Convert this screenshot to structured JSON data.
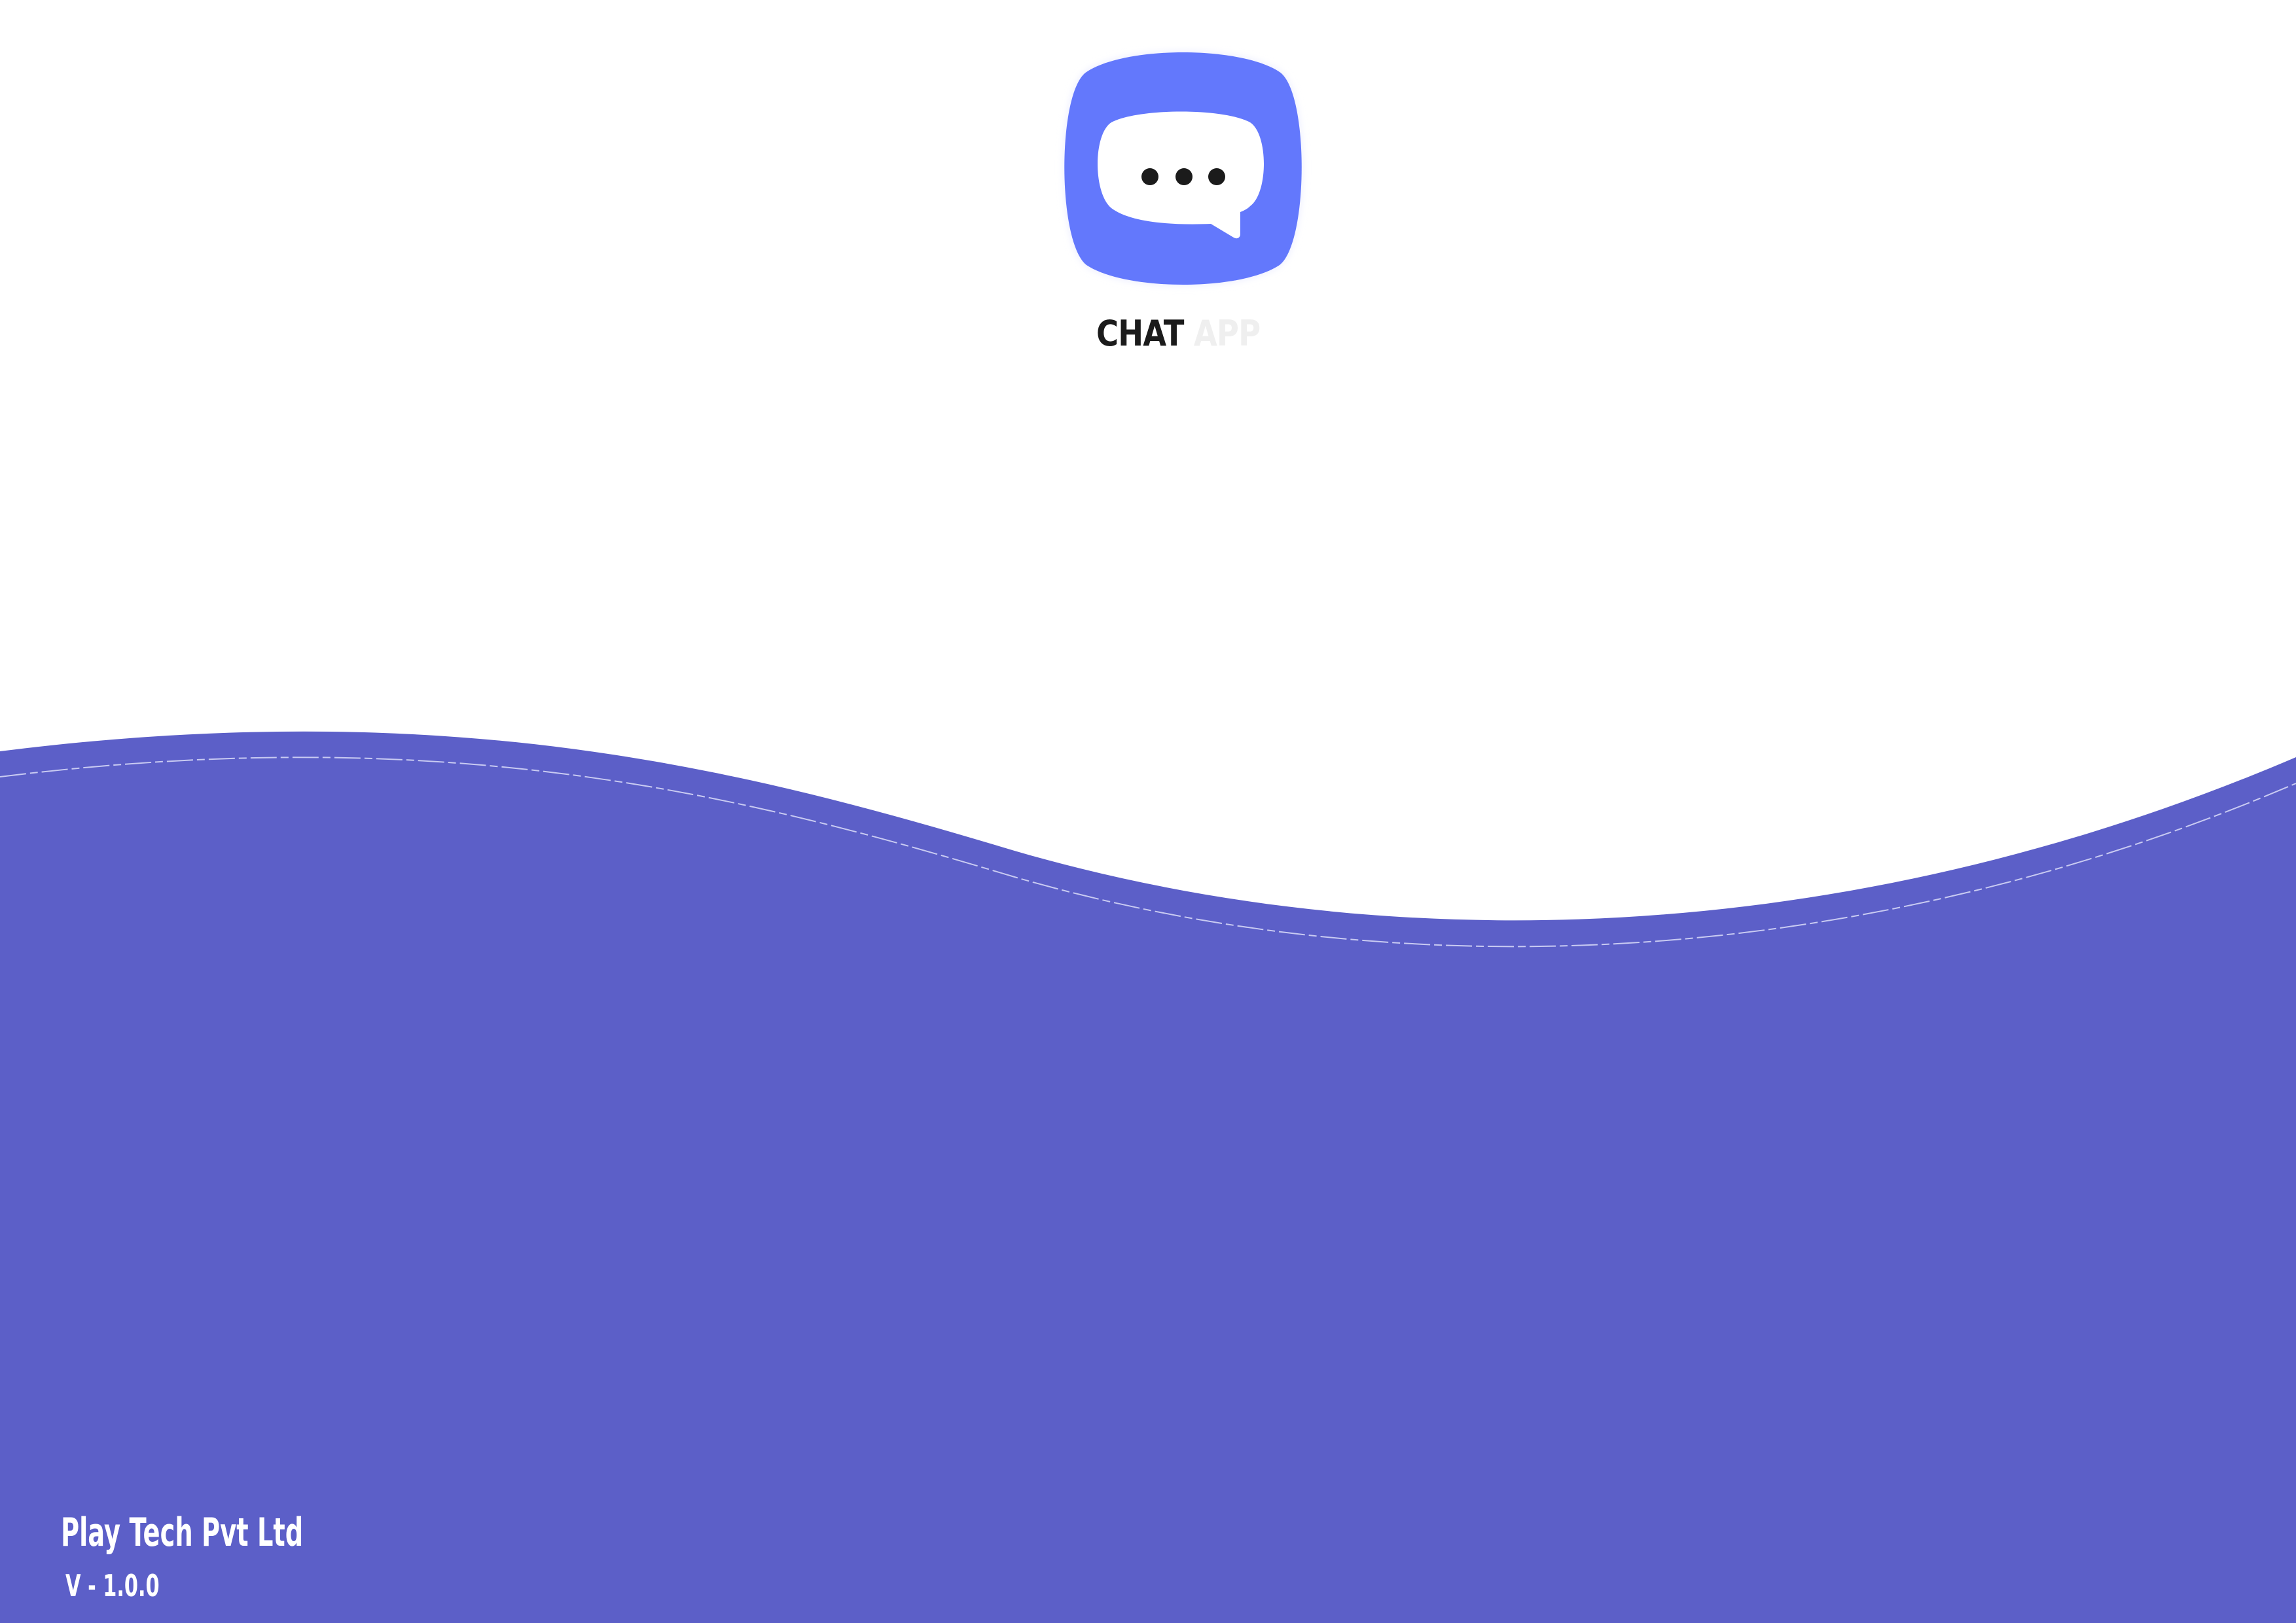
{
  "brand": {
    "word1": "CHAT",
    "word2": "APP"
  },
  "footer": {
    "company": "Play Tech Pvt Ltd",
    "version": "V - 1.0.0"
  },
  "colors": {
    "wave": "#5c5fc8",
    "logo": "#6378fc",
    "background": "#ffffff"
  },
  "icons": {
    "logo": "chat-bubble-icon"
  }
}
